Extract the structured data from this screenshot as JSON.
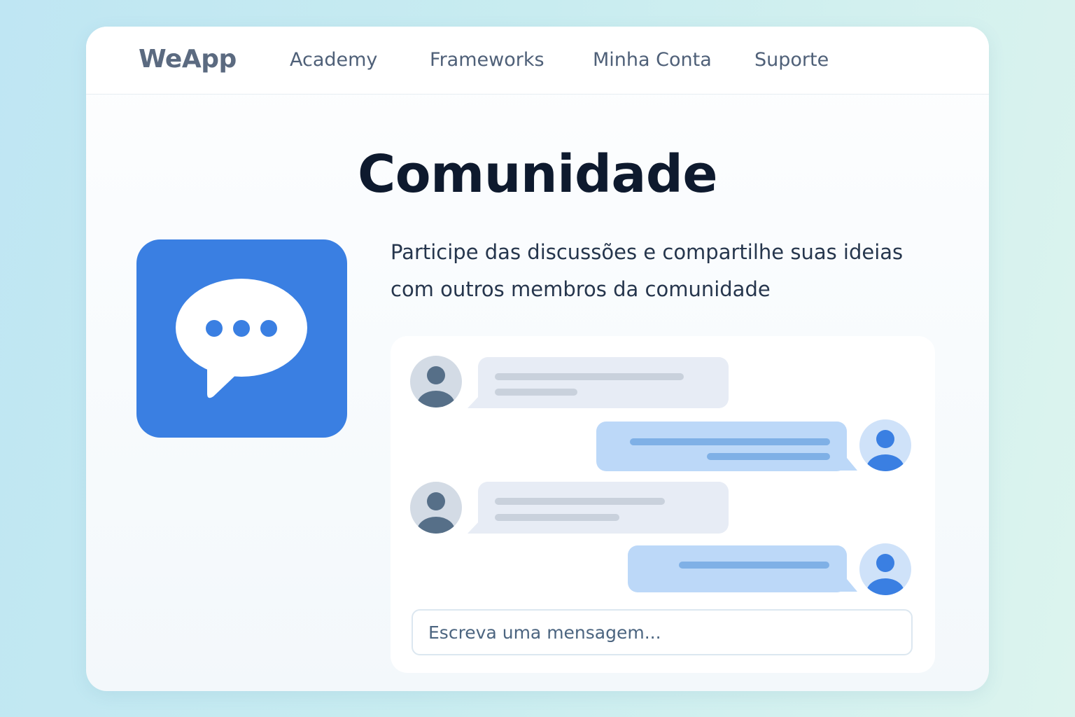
{
  "header": {
    "brand": "WeApp",
    "nav": [
      {
        "label": "Academy"
      },
      {
        "label": "Frameworks"
      },
      {
        "label": "Minha Conta"
      },
      {
        "label": "Suporte"
      }
    ]
  },
  "main": {
    "title": "Comunidade",
    "icon": "chat-bubble-icon",
    "description": "Participe das discussões e compartilhe suas ideias com outros membros da comunidade"
  },
  "chat": {
    "input_placeholder": "Escreva uma mensagem...",
    "messages": [
      {
        "side": "incoming",
        "avatar": "user-avatar-icon"
      },
      {
        "side": "outgoing",
        "avatar": "user-avatar-icon"
      },
      {
        "side": "incoming",
        "avatar": "user-avatar-icon"
      },
      {
        "side": "outgoing",
        "avatar": "user-avatar-icon"
      }
    ]
  },
  "colors": {
    "accent": "#3a7fe2",
    "incoming_bubble": "#e7ecf5",
    "outgoing_bubble": "#bcd8f8",
    "title": "#0e1a2e"
  }
}
